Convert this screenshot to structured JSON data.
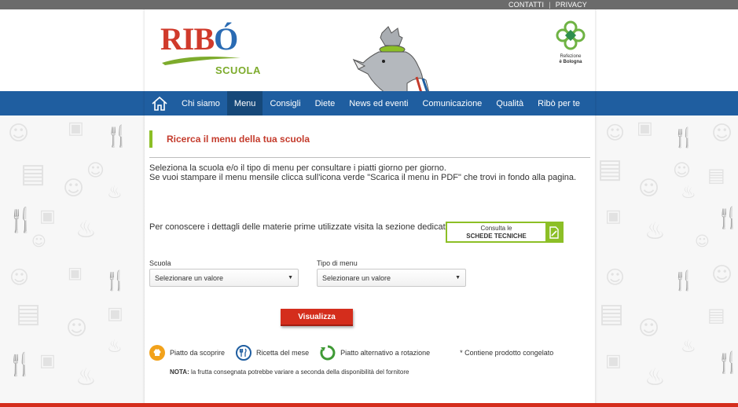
{
  "topbar": {
    "links": [
      "CONTATTI",
      "PRIVACY"
    ]
  },
  "header": {
    "logo_text_red": "RIB",
    "logo_text_blue": "Ó",
    "logo_sub": "SCUOLA",
    "partner_line1": "Refezione",
    "partner_line2": "è Bologna"
  },
  "nav": {
    "home_icon": "home-icon",
    "items": [
      {
        "label": "Chi siamo",
        "active": false
      },
      {
        "label": "Menu",
        "active": true
      },
      {
        "label": "Consigli",
        "active": false
      },
      {
        "label": "Diete",
        "active": false
      },
      {
        "label": "News ed eventi",
        "active": false
      },
      {
        "label": "Comunicazione",
        "active": false
      },
      {
        "label": "Qualità",
        "active": false
      },
      {
        "label": "Ribò per te",
        "active": false
      }
    ]
  },
  "main": {
    "title": "Ricerca il menu della tua scuola",
    "intro_line1": "Seleziona la scuola e/o il tipo di menu per consultare i piatti giorno per giorno.",
    "intro_line2": "Se vuoi stampare il menu mensile clicca sull'icona verde \"Scarica il menu in PDF\" che trovi in fondo alla pagina.",
    "materie_text": "Per conoscere i dettagli delle materie prime utilizzate visita la sezione dedicata",
    "schede_line1": "Consulta le",
    "schede_line2": "SCHEDE TECNICHE",
    "scuola_label": "Scuola",
    "scuola_value": "Selezionare un valore",
    "tipo_label": "Tipo di menu",
    "tipo_value": "Selezionare un valore",
    "visualizza": "Visualizza"
  },
  "legend": {
    "items": [
      {
        "label": "Piatto da scoprire",
        "icon": "chef-hat-icon",
        "color": "#f2a21b"
      },
      {
        "label": "Ricetta del mese",
        "icon": "cutlery-icon",
        "color": "#1f5ea0"
      },
      {
        "label": "Piatto alternativo a rotazione",
        "icon": "rotation-icon",
        "color": "#3f9a35"
      }
    ],
    "frozen_note": "* Contiene prodotto congelato",
    "nota_label": "NOTA:",
    "nota_text": " la frutta consegnata potrebbe variare a seconda della disponibilità del fornitore"
  },
  "colors": {
    "nav_blue": "#1f5ea0",
    "nav_active": "#164879",
    "accent_red": "#d42d1c",
    "accent_green": "#8cbf26",
    "title_red": "#c43b2c"
  }
}
